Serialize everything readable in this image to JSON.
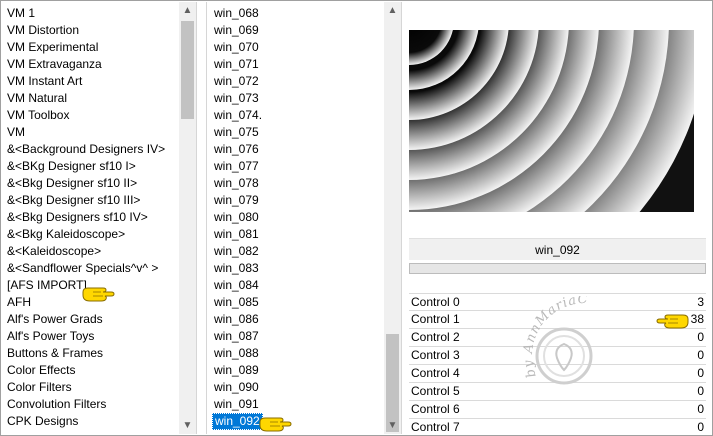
{
  "categories": [
    "VM 1",
    "VM Distortion",
    "VM Experimental",
    "VM Extravaganza",
    "VM Instant Art",
    "VM Natural",
    "VM Toolbox",
    "VM",
    "&<Background Designers IV>",
    "&<BKg Designer sf10 I>",
    "&<Bkg Designer sf10 II>",
    "&<Bkg Designer sf10 III>",
    "&<Bkg Designers sf10 IV>",
    "&<Bkg Kaleidoscope>",
    "&<Kaleidoscope>",
    "&<Sandflower Specials^v^ >",
    "[AFS IMPORT]",
    "AFH",
    "Alf's Power Grads",
    "Alf's Power Toys",
    "Buttons & Frames",
    "Color Effects",
    "Color Filters",
    "Convolution Filters",
    "CPK Designs"
  ],
  "filters": [
    "win_068",
    "win_069",
    "win_070",
    "win_071",
    "win_072",
    "win_073",
    "win_074.",
    "win_075",
    "win_076",
    "win_077",
    "win_078",
    "win_079",
    "win_080",
    "win_081",
    "win_082",
    "win_083",
    "win_084",
    "win_085",
    "win_086",
    "win_087",
    "win_088",
    "win_089",
    "win_090",
    "win_091",
    "win_092"
  ],
  "selected_filter": "win_092",
  "filter_title": "win_092",
  "controls": [
    {
      "label": "Control 0",
      "value": "3"
    },
    {
      "label": "Control 1",
      "value": "38"
    },
    {
      "label": "Control 2",
      "value": "0"
    },
    {
      "label": "Control 3",
      "value": "0"
    },
    {
      "label": "Control 4",
      "value": "0"
    },
    {
      "label": "Control 5",
      "value": "0"
    },
    {
      "label": "Control 6",
      "value": "0"
    },
    {
      "label": "Control 7",
      "value": "0"
    }
  ],
  "scroll": {
    "up_glyph": "▲",
    "down_glyph": "▼"
  },
  "watermark_text": "by AnnMariaC",
  "icons": {
    "pointer": "pointing-hand-icon",
    "watermark": "watermark-seal-icon"
  },
  "colors": {
    "selection": "#0078d7",
    "pointer_fill": "#ffd700"
  }
}
